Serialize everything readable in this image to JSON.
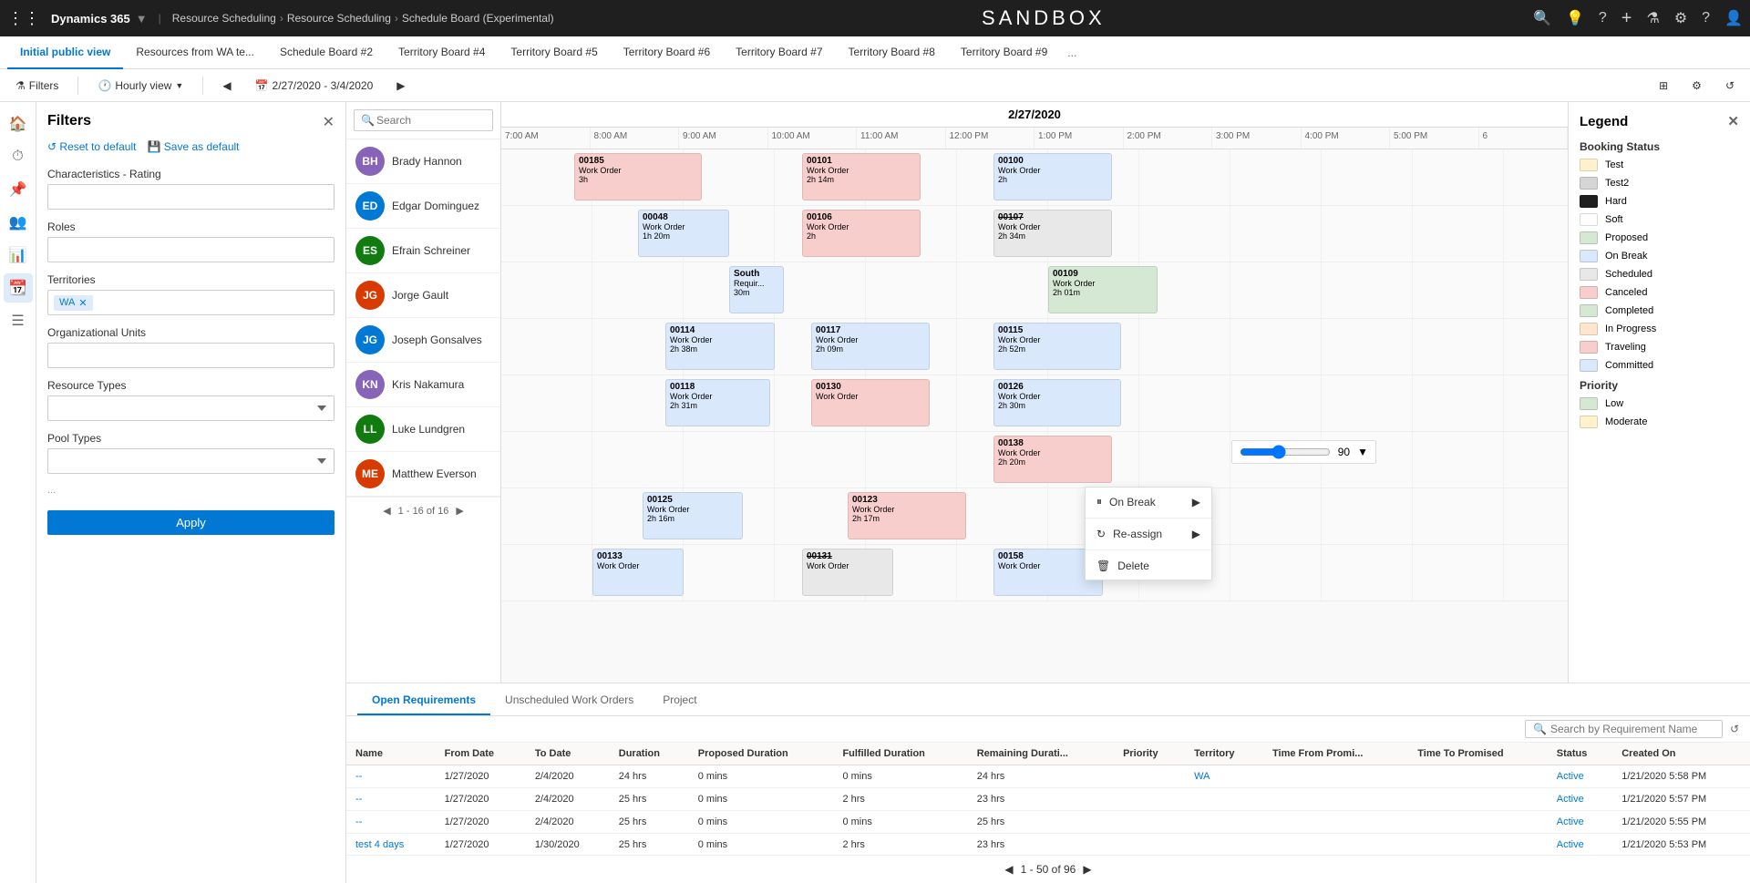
{
  "topNav": {
    "brand": "Dynamics 365",
    "nav1": "Resource Scheduling",
    "nav2": "Resource Scheduling",
    "nav3": "Schedule Board (Experimental)",
    "title": "SANDBOX",
    "icons": [
      "search",
      "lightbulb",
      "help",
      "plus",
      "filter",
      "settings",
      "help2",
      "user"
    ]
  },
  "tabs": [
    {
      "label": "Initial public view",
      "active": true
    },
    {
      "label": "Resources from WA te..."
    },
    {
      "label": "Schedule Board #2"
    },
    {
      "label": "Territory Board #4"
    },
    {
      "label": "Territory Board #5"
    },
    {
      "label": "Territory Board #6"
    },
    {
      "label": "Territory Board #7"
    },
    {
      "label": "Territory Board #8"
    },
    {
      "label": "Territory Board #9"
    },
    {
      "label": "..."
    }
  ],
  "toolbar": {
    "filters_label": "Filters",
    "view_label": "Hourly view",
    "date_range": "2/27/2020 - 3/4/2020"
  },
  "filterPanel": {
    "title": "Filters",
    "reset_label": "Reset to default",
    "save_label": "Save as default",
    "sections": [
      {
        "label": "Characteristics - Rating"
      },
      {
        "label": "Roles"
      },
      {
        "label": "Territories",
        "tag": "WA"
      },
      {
        "label": "Organizational Units"
      },
      {
        "label": "Resource Types"
      },
      {
        "label": "Pool Types"
      }
    ],
    "apply_label": "Apply"
  },
  "resourceSearch": {
    "placeholder": "Search"
  },
  "resources": [
    {
      "name": "Brady Hannon",
      "initials": "BH",
      "color": "#8764b8"
    },
    {
      "name": "Edgar Dominguez",
      "initials": "ED",
      "color": "#0078d4"
    },
    {
      "name": "Efrain Schreiner",
      "initials": "ES",
      "color": "#107c10"
    },
    {
      "name": "Jorge Gault",
      "initials": "JG",
      "color": "#d83b01"
    },
    {
      "name": "Joseph Gonsalves",
      "initials": "JG2",
      "color": "#0078d4"
    },
    {
      "name": "Kris Nakamura",
      "initials": "KN",
      "color": "#8764b8"
    },
    {
      "name": "Luke Lundgren",
      "initials": "LL",
      "color": "#107c10"
    },
    {
      "name": "Matthew Everson",
      "initials": "ME",
      "color": "#d83b01"
    }
  ],
  "resourcePagination": "1 - 16 of 16",
  "scheduleDate": "2/27/2020",
  "timeSlots": [
    "7:00 AM",
    "8:00 AM",
    "9:00 AM",
    "10:00 AM",
    "11:00 AM",
    "12:00 PM",
    "1:00 PM",
    "2:00 PM",
    "3:00 PM",
    "4:00 PM",
    "5:00 PM",
    "6"
  ],
  "contextMenu": {
    "items": [
      {
        "label": "On Break",
        "icon": "☕",
        "has_submenu": true
      },
      {
        "label": "Re-assign",
        "icon": "↻",
        "has_submenu": true
      },
      {
        "label": "Delete",
        "icon": "🗑"
      }
    ]
  },
  "legend": {
    "title": "Legend",
    "bookingStatus": {
      "label": "Booking Status",
      "items": [
        {
          "label": "Test",
          "color": "#fff2cc",
          "icon": null
        },
        {
          "label": "Test2",
          "color": "#d6d6d6",
          "icon": null
        },
        {
          "label": "Hard",
          "color": "#1f1f1f",
          "icon": "●",
          "icon_color": "#fff"
        },
        {
          "label": "Soft",
          "color": "#fff",
          "icon": "●",
          "icon_color": "#333"
        },
        {
          "label": "Proposed",
          "color": "#d5e8d4",
          "icon": null
        },
        {
          "label": "On Break",
          "color": "#dae8fc",
          "icon": null
        },
        {
          "label": "Scheduled",
          "color": "#e8e8e8",
          "icon": "⏰",
          "icon_color": "#333"
        },
        {
          "label": "Canceled",
          "color": "#f8cecc",
          "icon": "✕",
          "strikethrough": true
        },
        {
          "label": "Completed",
          "color": "#d5e8d4",
          "icon": "✓"
        },
        {
          "label": "In Progress",
          "color": "#ffe6cc",
          "icon": "···"
        },
        {
          "label": "Traveling",
          "color": "#f8cecc",
          "icon": "⏰"
        },
        {
          "label": "Committed",
          "color": "#dae8fc",
          "icon": "⏰"
        }
      ]
    },
    "priority": {
      "label": "Priority",
      "items": [
        {
          "label": "Low",
          "color": "#d5e8d4"
        },
        {
          "label": "Moderate",
          "color": "#fff2cc"
        }
      ]
    }
  },
  "bottomTabs": [
    {
      "label": "Open Requirements",
      "active": true
    },
    {
      "label": "Unscheduled Work Orders"
    },
    {
      "label": "Project"
    }
  ],
  "bottomSearch": {
    "placeholder": "Search by Requirement Name"
  },
  "tableHeaders": [
    "Name",
    "From Date",
    "To Date",
    "Duration",
    "Proposed Duration",
    "Fulfilled Duration",
    "Remaining Durati...",
    "Priority",
    "Territory",
    "Time From Promi...",
    "Time To Promised",
    "Status",
    "Created On"
  ],
  "tableRows": [
    {
      "name": "--",
      "from": "1/27/2020",
      "to": "2/4/2020",
      "duration": "24 hrs",
      "proposed": "0 mins",
      "fulfilled": "0 mins",
      "remaining": "24 hrs",
      "priority": "",
      "territory": "WA",
      "timeFrom": "",
      "timeTo": "",
      "status": "Active",
      "created": "1/21/2020 5:58 PM"
    },
    {
      "name": "--",
      "from": "1/27/2020",
      "to": "2/4/2020",
      "duration": "25 hrs",
      "proposed": "0 mins",
      "fulfilled": "2 hrs",
      "remaining": "23 hrs",
      "priority": "",
      "territory": "",
      "timeFrom": "",
      "timeTo": "",
      "status": "Active",
      "created": "1/21/2020 5:57 PM"
    },
    {
      "name": "--",
      "from": "1/27/2020",
      "to": "2/4/2020",
      "duration": "25 hrs",
      "proposed": "0 mins",
      "fulfilled": "0 mins",
      "remaining": "25 hrs",
      "priority": "",
      "territory": "",
      "timeFrom": "",
      "timeTo": "",
      "status": "Active",
      "created": "1/21/2020 5:55 PM"
    },
    {
      "name": "test 4 days",
      "from": "1/27/2020",
      "to": "1/30/2020",
      "duration": "25 hrs",
      "proposed": "0 mins",
      "fulfilled": "2 hrs",
      "remaining": "23 hrs",
      "priority": "",
      "territory": "",
      "timeFrom": "",
      "timeTo": "",
      "status": "Active",
      "created": "1/21/2020 5:53 PM"
    }
  ],
  "bottomPagination": {
    "label": "1 - 50 of 96"
  },
  "zoom": {
    "value": 90
  }
}
